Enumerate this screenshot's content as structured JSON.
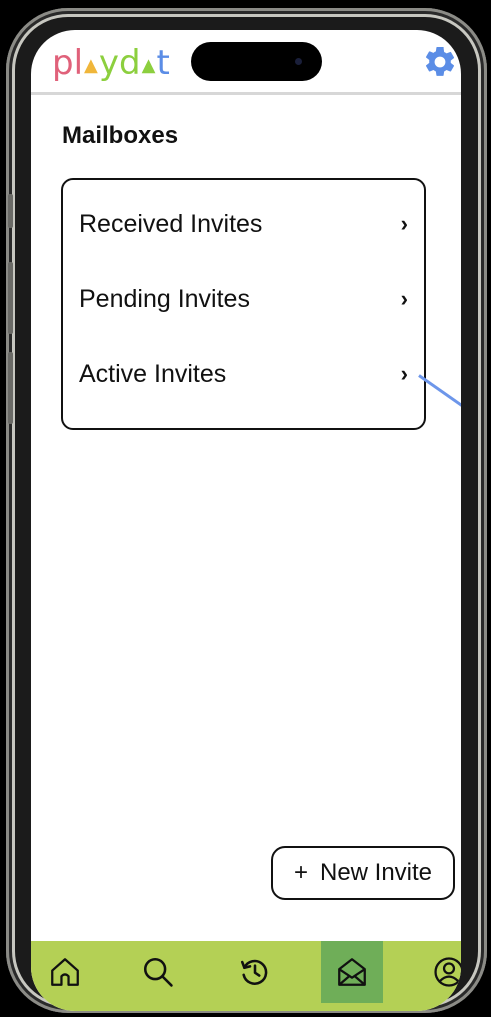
{
  "app": {
    "logo_letters": [
      {
        "char": "p",
        "color": "#e0617a"
      },
      {
        "char": "l",
        "color": "#e0617a"
      },
      {
        "char": "▲",
        "color": "#f0b63a"
      },
      {
        "char": "y",
        "color": "#8ccf3e"
      },
      {
        "char": "d",
        "color": "#8ccf3e"
      },
      {
        "char": "▲",
        "color": "#8ccf3e"
      },
      {
        "char": "t",
        "color": "#5b8de6"
      }
    ],
    "settings_icon": "gear-icon",
    "accent": "#5b8de6"
  },
  "page": {
    "title": "Mailboxes"
  },
  "mailboxes": {
    "items": [
      {
        "label": "Received Invites",
        "chevron": "›"
      },
      {
        "label": "Pending Invites",
        "chevron": "›"
      },
      {
        "label": "Active Invites",
        "chevron": "›"
      }
    ]
  },
  "actions": {
    "new_invite_plus": "+",
    "new_invite_label": "New Invite"
  },
  "tabbar": {
    "color": "#b4d055",
    "active_color": "#6fae58",
    "items": [
      {
        "icon": "home-icon"
      },
      {
        "icon": "search-icon"
      },
      {
        "icon": "history-icon"
      },
      {
        "icon": "mailbox-icon",
        "active": true
      },
      {
        "icon": "profile-icon"
      }
    ]
  }
}
